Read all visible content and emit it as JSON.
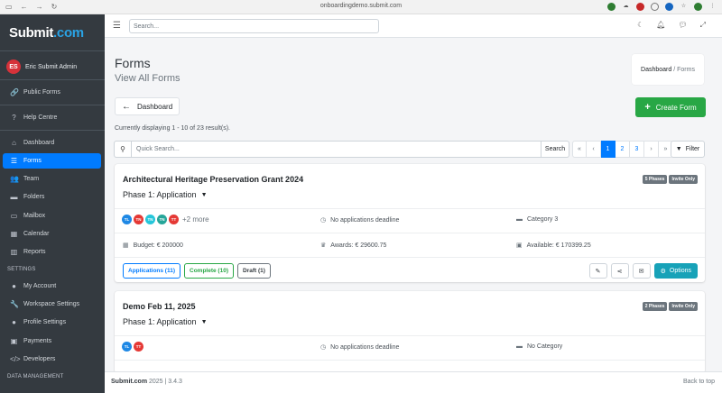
{
  "browser": {
    "url": "onboardingdemo.submit.com"
  },
  "logo": {
    "main": "Submit",
    "dot": ".",
    "tld": "com"
  },
  "user": {
    "initials": "ES",
    "name": "Eric Submit Admin"
  },
  "sidebar": {
    "items_top": [
      {
        "label": "Public Forms",
        "icon": "link-icon"
      },
      {
        "label": "Help Centre",
        "icon": "question-icon"
      }
    ],
    "items_main": [
      {
        "label": "Dashboard",
        "icon": "home-icon"
      },
      {
        "label": "Forms",
        "icon": "list-icon"
      },
      {
        "label": "Team",
        "icon": "users-icon"
      },
      {
        "label": "Folders",
        "icon": "folder-icon"
      },
      {
        "label": "Mailbox",
        "icon": "inbox-icon"
      },
      {
        "label": "Calendar",
        "icon": "calendar-icon"
      },
      {
        "label": "Reports",
        "icon": "chart-icon"
      }
    ],
    "settings_header": "SETTINGS",
    "items_settings": [
      {
        "label": "My Account",
        "icon": "user-icon"
      },
      {
        "label": "Workspace Settings",
        "icon": "wrench-icon"
      },
      {
        "label": "Profile Settings",
        "icon": "user-cog-icon"
      },
      {
        "label": "Payments",
        "icon": "money-icon"
      },
      {
        "label": "Developers",
        "icon": "code-icon"
      }
    ],
    "data_header": "DATA MANAGEMENT"
  },
  "topbar": {
    "search_placeholder": "Search..."
  },
  "page": {
    "title": "Forms",
    "subtitle": "View All Forms",
    "breadcrumb": {
      "home": "Dashboard",
      "sep": "/",
      "current": "Forms"
    },
    "dashboard_btn": "Dashboard",
    "create_btn": "Create Form",
    "displaying": "Currently displaying 1 - 10 of 23 result(s).",
    "quick_search_placeholder": "Quick Search...",
    "search_btn": "Search",
    "pager": [
      "«",
      "‹",
      "1",
      "2",
      "3",
      "›",
      "»"
    ],
    "filter_btn": "Filter"
  },
  "cards": [
    {
      "title": "Architectural Heritage Preservation Grant 2024",
      "phase": "Phase 1: Application",
      "badges": [
        "5 Phases",
        "Invite Only"
      ],
      "avatars": [
        {
          "initials": "TL",
          "color": "#1e88e5"
        },
        {
          "initials": "TN",
          "color": "#e53935"
        },
        {
          "initials": "TN",
          "color": "#26c6da"
        },
        {
          "initials": "TN",
          "color": "#26a69a"
        },
        {
          "initials": "TT",
          "color": "#e53935"
        }
      ],
      "more": "+2 more",
      "deadline": "No applications deadline",
      "category": "Category 3",
      "budget": "Budget: € 200000",
      "awards": "Awards: € 29600.75",
      "available": "Available: € 170399.25",
      "status": {
        "applications": "Applications (11)",
        "complete": "Complete (10)",
        "draft": "Draft (1)"
      },
      "options": "Options"
    },
    {
      "title": "Demo Feb 11, 2025",
      "phase": "Phase 1: Application",
      "badges": [
        "2 Phases",
        "Invite Only"
      ],
      "avatars": [
        {
          "initials": "TL",
          "color": "#1e88e5"
        },
        {
          "initials": "TT",
          "color": "#e53935"
        }
      ],
      "deadline": "No applications deadline",
      "category": "No Category"
    }
  ],
  "footer": {
    "brand": "Submit.com",
    "text": " 2025 | 3.4.3",
    "back": "Back to top"
  }
}
